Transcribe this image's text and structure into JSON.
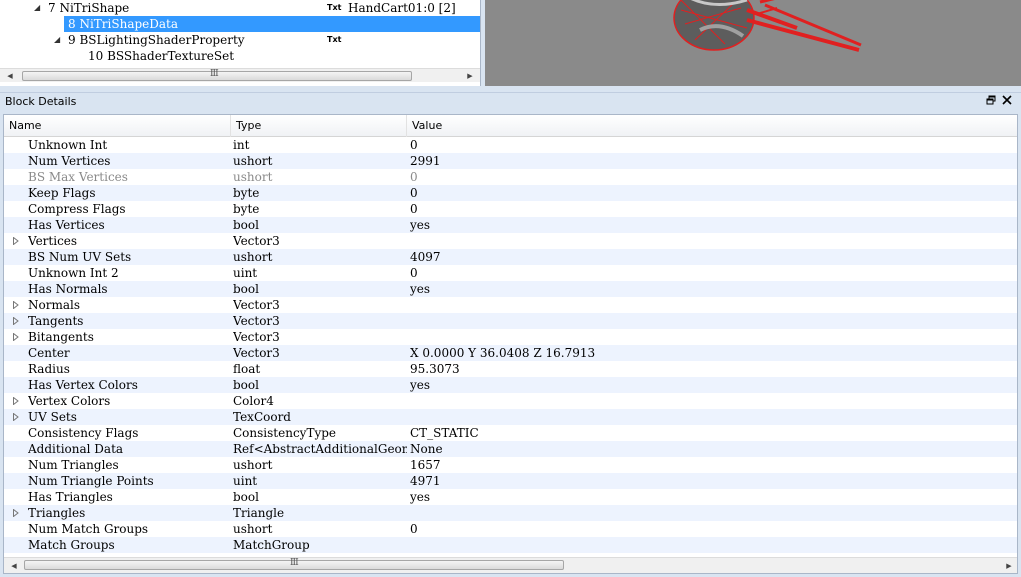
{
  "tree": {
    "rows": [
      {
        "id": "row-7",
        "label": "7 NiTriShape",
        "arrow": "◢",
        "txt": "Txt",
        "value": "HandCart01:0 [2]"
      },
      {
        "id": "row-8",
        "label": "8 NiTriShapeData",
        "arrow": "",
        "txt": "",
        "value": ""
      },
      {
        "id": "row-9",
        "label": "9 BSLightingShaderProperty",
        "arrow": "◢",
        "txt": "Txt",
        "value": ""
      },
      {
        "id": "row-10",
        "label": "10 BSShaderTextureSet",
        "arrow": "",
        "txt": "",
        "value": ""
      }
    ],
    "scroll_left": "◀",
    "scroll_right": "▶",
    "scroll_grip": "III"
  },
  "details": {
    "title": "Block Details",
    "float_icon": "restore-icon",
    "close_icon": "close-icon",
    "columns": {
      "name": "Name",
      "type": "Type",
      "value": "Value"
    },
    "rows": [
      {
        "name": "Unknown Int",
        "type": "int",
        "value": "0"
      },
      {
        "name": "Num Vertices",
        "type": "ushort",
        "value": "2991"
      },
      {
        "name": "BS Max Vertices",
        "type": "ushort",
        "value": "0",
        "disabled": true
      },
      {
        "name": "Keep Flags",
        "type": "byte",
        "value": "0"
      },
      {
        "name": "Compress Flags",
        "type": "byte",
        "value": "0"
      },
      {
        "name": "Has Vertices",
        "type": "bool",
        "value": "yes"
      },
      {
        "name": "Vertices",
        "type": "Vector3",
        "value": "",
        "array": true,
        "expandable": true
      },
      {
        "name": "BS Num UV Sets",
        "type": "ushort",
        "value": "4097"
      },
      {
        "name": "Unknown Int 2",
        "type": "uint",
        "value": "0"
      },
      {
        "name": "Has Normals",
        "type": "bool",
        "value": "yes"
      },
      {
        "name": "Normals",
        "type": "Vector3",
        "value": "",
        "array": true,
        "expandable": true
      },
      {
        "name": "Tangents",
        "type": "Vector3",
        "value": "",
        "array": true,
        "expandable": true
      },
      {
        "name": "Bitangents",
        "type": "Vector3",
        "value": "",
        "array": true,
        "expandable": true
      },
      {
        "name": "Center",
        "type": "Vector3",
        "value": "X 0.0000 Y 36.0408 Z 16.7913"
      },
      {
        "name": "Radius",
        "type": "float",
        "value": "95.3073"
      },
      {
        "name": "Has Vertex Colors",
        "type": "bool",
        "value": "yes"
      },
      {
        "name": "Vertex Colors",
        "type": "Color4",
        "value": "",
        "array": true,
        "expandable": true
      },
      {
        "name": "UV Sets",
        "type": "TexCoord",
        "value": "",
        "array": true,
        "expandable": true
      },
      {
        "name": "Consistency Flags",
        "type": "ConsistencyType",
        "value": "CT_STATIC"
      },
      {
        "name": "Additional Data",
        "type": "Ref<AbstractAdditionalGeom...",
        "value": "None"
      },
      {
        "name": "Num Triangles",
        "type": "ushort",
        "value": "1657"
      },
      {
        "name": "Num Triangle Points",
        "type": "uint",
        "value": "4971"
      },
      {
        "name": "Has Triangles",
        "type": "bool",
        "value": "yes"
      },
      {
        "name": "Triangles",
        "type": "Triangle",
        "value": "",
        "array": true,
        "expandable": true
      },
      {
        "name": "Num Match Groups",
        "type": "ushort",
        "value": "0"
      },
      {
        "name": "Match Groups",
        "type": "MatchGroup",
        "value": "",
        "array": true,
        "expandable": false
      }
    ],
    "scroll_left": "◀",
    "scroll_right": "▶",
    "scroll_grip": "III"
  },
  "colors": {
    "selection": "#3399ff",
    "alt_row": "#edf3fe",
    "panel_bg": "#d9e4f1",
    "array_icon": "#3c9a3c"
  }
}
